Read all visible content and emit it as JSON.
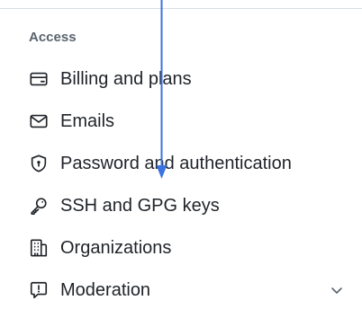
{
  "sidebar": {
    "section_heading": "Access",
    "items": [
      {
        "label": "Billing and plans",
        "icon": "credit-card-icon"
      },
      {
        "label": "Emails",
        "icon": "mail-icon"
      },
      {
        "label": "Password and authentication",
        "icon": "shield-lock-icon"
      },
      {
        "label": "SSH and GPG keys",
        "icon": "key-icon"
      },
      {
        "label": "Organizations",
        "icon": "organization-icon"
      },
      {
        "label": "Moderation",
        "icon": "report-icon",
        "expandable": true
      }
    ]
  },
  "colors": {
    "text": "#1f2328",
    "muted": "#59636e",
    "divider": "#d8dee4",
    "drag_arrow": "#3b73e0"
  }
}
